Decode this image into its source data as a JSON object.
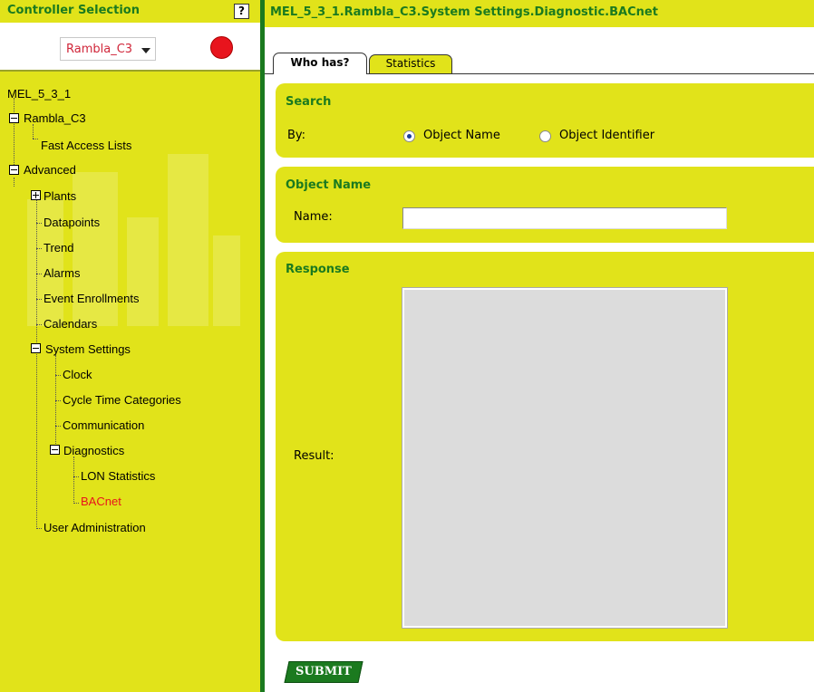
{
  "sidebar": {
    "title": "Controller Selection",
    "help_label": "?",
    "controller_value": "Rambla_C3",
    "tree": {
      "root": "MEL_5_3_1",
      "rambla": "Rambla_C3",
      "fast_access": "Fast Access Lists",
      "advanced": "Advanced",
      "plants": "Plants",
      "datapoints": "Datapoints",
      "trend": "Trend",
      "alarms": "Alarms",
      "event_enrollments": "Event Enrollments",
      "calendars": "Calendars",
      "system_settings": "System Settings",
      "clock": "Clock",
      "cycle_time": "Cycle Time Categories",
      "communication": "Communication",
      "diagnostics": "Diagnostics",
      "lon_statistics": "LON Statistics",
      "bacnet": "BACnet",
      "user_admin": "User Administration"
    }
  },
  "main": {
    "breadcrumb": "MEL_5_3_1.Rambla_C3.System Settings.Diagnostic.BACnet",
    "tabs": {
      "who_has": "Who has?",
      "statistics": "Statistics"
    },
    "search": {
      "title": "Search",
      "by_label": "By:",
      "option_object_name": "Object Name",
      "option_object_identifier": "Object Identifier",
      "selected": "Object Name"
    },
    "object_name": {
      "title": "Object Name",
      "name_label": "Name:",
      "name_value": ""
    },
    "response": {
      "title": "Response",
      "result_label": "Result:",
      "result_value": ""
    },
    "submit_label": "SUBMIT"
  },
  "colors": {
    "accent_yellow": "#e1e31a",
    "accent_green": "#1b7a1f",
    "status_red": "#e8141d"
  }
}
